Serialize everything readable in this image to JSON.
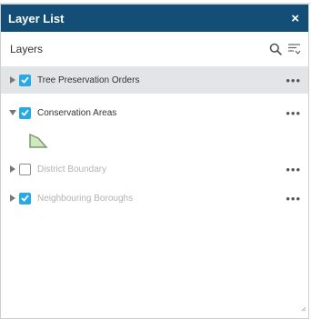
{
  "window": {
    "title": "Layer List",
    "close_glyph": "×"
  },
  "header": {
    "label": "Layers",
    "search_icon": "search-icon",
    "filter_icon": "filter-icon"
  },
  "layers": [
    {
      "name": "Tree Preservation Orders",
      "checked": true,
      "expanded": false,
      "dimmed": false,
      "selected": true
    },
    {
      "name": "Conservation Areas",
      "checked": true,
      "expanded": true,
      "dimmed": false,
      "selected": false,
      "legend": {
        "fill": "#cfe8c0",
        "stroke": "#7c9a6a"
      }
    },
    {
      "name": "District Boundary",
      "checked": false,
      "expanded": false,
      "dimmed": true,
      "selected": false
    },
    {
      "name": "Neighbouring Boroughs",
      "checked": true,
      "expanded": false,
      "dimmed": true,
      "selected": false
    }
  ],
  "more_glyph": "•••",
  "colors": {
    "titlebar": "#134e77",
    "checkbox": "#27a9e6",
    "selected_row": "#e3e4e5"
  }
}
